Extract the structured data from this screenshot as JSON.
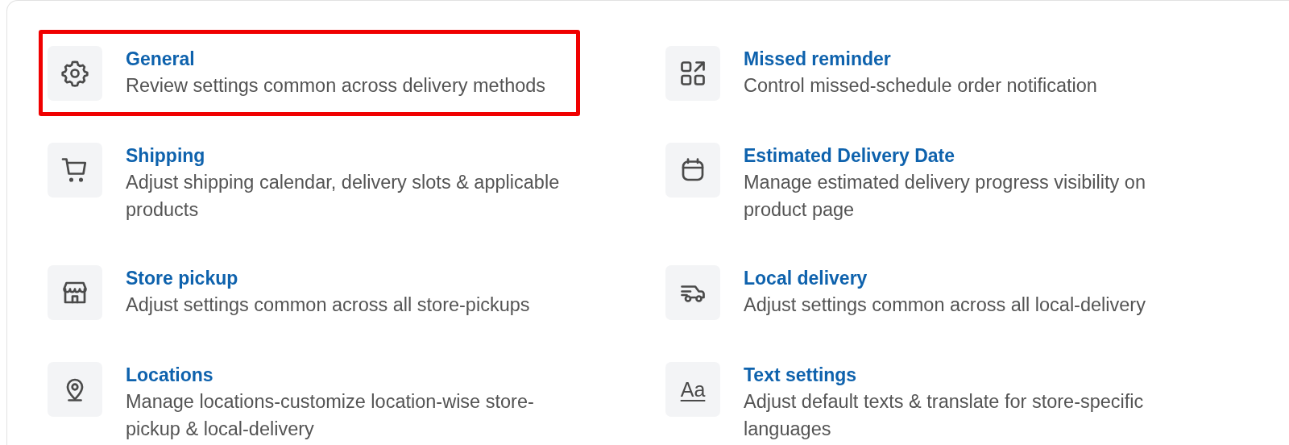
{
  "settings": [
    {
      "title": "General",
      "description": "Review settings common across delivery methods",
      "highlighted": true
    },
    {
      "title": "Missed reminder",
      "description": "Control missed-schedule order notification"
    },
    {
      "title": "Shipping",
      "description": "Adjust shipping calendar, delivery slots & applicable products"
    },
    {
      "title": "Estimated Delivery Date",
      "description": "Manage estimated delivery progress visibility on product page"
    },
    {
      "title": "Store pickup",
      "description": "Adjust settings common across all store-pickups"
    },
    {
      "title": "Local delivery",
      "description": "Adjust settings common across all local-delivery"
    },
    {
      "title": "Locations",
      "description": "Manage locations-customize location-wise store-pickup & local-delivery"
    },
    {
      "title": "Text settings",
      "description": "Adjust default texts & translate for store-specific languages",
      "icon_label": "Aa"
    }
  ]
}
